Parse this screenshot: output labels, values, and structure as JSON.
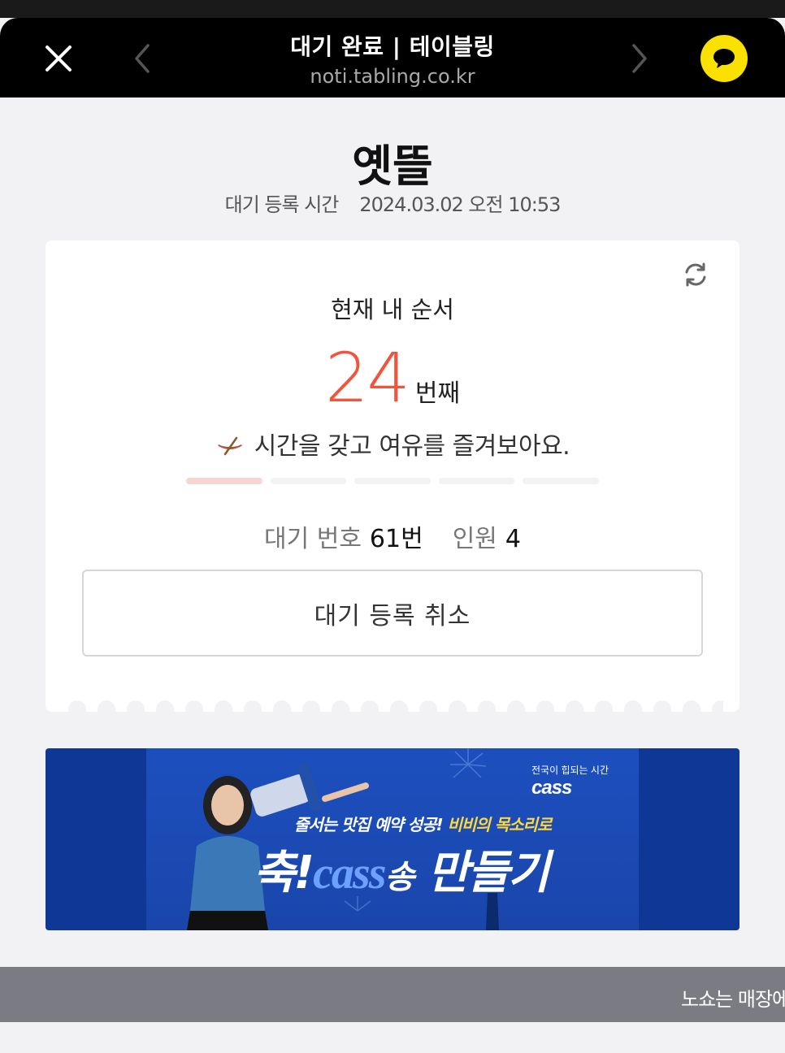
{
  "nav": {
    "title": "대기 완료 | 테이블링",
    "url": "noti.tabling.co.kr",
    "close_icon": "close-icon",
    "back_icon": "chevron-left-icon",
    "forward_icon": "chevron-right-icon",
    "share_icon": "kakao-talk-icon"
  },
  "store": {
    "name": "옛뜰",
    "reg_time_label": "대기 등록 시간",
    "reg_time_value": "2024.03.02 오전 10:53"
  },
  "card": {
    "order_label": "현재 내 순서",
    "rank_number": "24",
    "rank_unit": "번째",
    "message": "시간을 갖고 여유를 즐겨보아요.",
    "progress_segments": 5,
    "progress_active": 1,
    "wait_no_label": "대기 번호",
    "wait_no_value": "61번",
    "party_label": "인원",
    "party_value": "4",
    "cancel_label": "대기 등록 취소"
  },
  "banner": {
    "brand_small": "전국이 힙되는 시간",
    "brand": "cass",
    "line1_a": "줄서는 맛집 예약 성공!",
    "line1_b": "비비의 목소리로",
    "line2_a": "축!",
    "line2_brand": "cass",
    "line2_b": "송",
    "line2_c": "만들기"
  },
  "bottom": {
    "marquee": "노쇼는 매장에"
  },
  "colors": {
    "accent": "#f2533a",
    "kakao": "#fae100",
    "banner_bg": "#0f3896"
  }
}
